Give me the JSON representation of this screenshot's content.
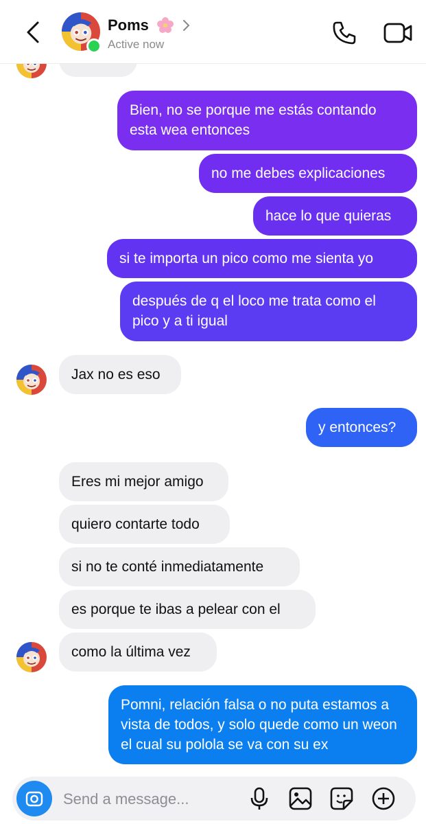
{
  "header": {
    "back_icon": "chevron-left-icon",
    "contact_name": "Poms",
    "name_emoji_icon": "cherry-blossom-icon",
    "status": "Active now",
    "call_icon": "phone-icon",
    "video_icon": "video-camera-icon"
  },
  "messages": [
    {
      "from": "me",
      "text": "Bien, no se porque me estás contando\nesta wea entonces"
    },
    {
      "from": "me",
      "text": "no me debes explicaciones"
    },
    {
      "from": "me",
      "text": "hace lo que quieras"
    },
    {
      "from": "me",
      "text": "si te importa un pico como me sienta yo"
    },
    {
      "from": "me",
      "text": "después de q el loco me trata como el\npico y a ti igual"
    },
    {
      "from": "them",
      "text": "Jax no es eso"
    },
    {
      "from": "me",
      "text": "y entonces?"
    },
    {
      "from": "them",
      "text": "Eres mi mejor amigo"
    },
    {
      "from": "them",
      "text": "quiero contarte todo"
    },
    {
      "from": "them",
      "text": "si no te conté inmediatamente"
    },
    {
      "from": "them",
      "text": "es porque te ibas a pelear con el"
    },
    {
      "from": "them",
      "text": "como la última vez"
    },
    {
      "from": "me",
      "text": "Pomni, relación falsa o no puta estamos a\nvista de todos, y solo quede como un weon\nel cual su polola se va con su ex"
    }
  ],
  "composer": {
    "placeholder": "Send a message...",
    "camera_icon": "camera-icon",
    "mic_icon": "microphone-icon",
    "gallery_icon": "image-icon",
    "sticker_icon": "sticker-icon",
    "more_icon": "plus-circle-icon"
  },
  "colors": {
    "outgoing_purple": "#7a2ff0",
    "outgoing_indigo": "#5b3cf2",
    "outgoing_blue": "#2e63f5",
    "outgoing_cyan": "#0b7ff0",
    "incoming_bubble": "#efeff2",
    "online": "#2bd152"
  }
}
